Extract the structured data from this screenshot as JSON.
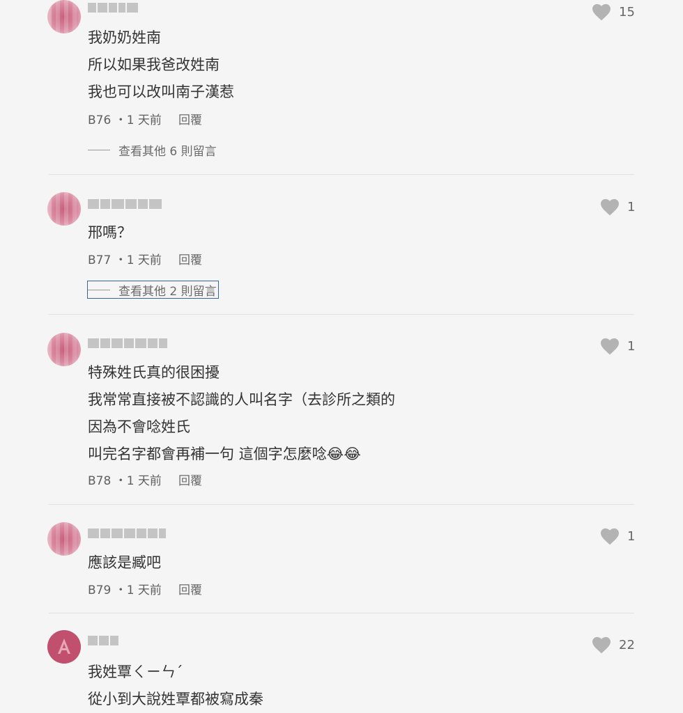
{
  "comments": [
    {
      "floor": "B76",
      "time": "1 天前",
      "reply": "回覆",
      "likes": "15",
      "lines": [
        "我奶奶姓南",
        "所以如果我爸改姓南",
        "我也可以改叫南子漢惹"
      ],
      "more_replies": "查看其他 6 則留言"
    },
    {
      "floor": "B77",
      "time": "1 天前",
      "reply": "回覆",
      "likes": "1",
      "lines": [
        "邢嗎？"
      ],
      "more_replies": "查看其他 2 則留言"
    },
    {
      "floor": "B78",
      "time": "1 天前",
      "reply": "回覆",
      "likes": "1",
      "lines": [
        "特殊姓氏真的很困擾",
        "我常常直接被不認識的人叫名字（去診所之類的",
        "因為不會唸姓氏",
        "叫完名字都會再補一句 這個字怎麼唸😂😂"
      ]
    },
    {
      "floor": "B79",
      "time": "1 天前",
      "reply": "回覆",
      "likes": "1",
      "lines": [
        "應該是臧吧"
      ]
    },
    {
      "likes": "22",
      "lines": [
        "我姓覃ㄑㄧㄣˊ",
        "從小到大說姓覃都被寫成秦"
      ]
    }
  ],
  "colors": {
    "background": "#f5f5f5",
    "text": "#333333",
    "meta": "#5f5f5f",
    "heart": "#b3b3b3",
    "avatar": "#d98aa0",
    "focus": "#3a64a8"
  },
  "icons": {
    "like": "heart-icon",
    "more": "dash-line-icon"
  }
}
